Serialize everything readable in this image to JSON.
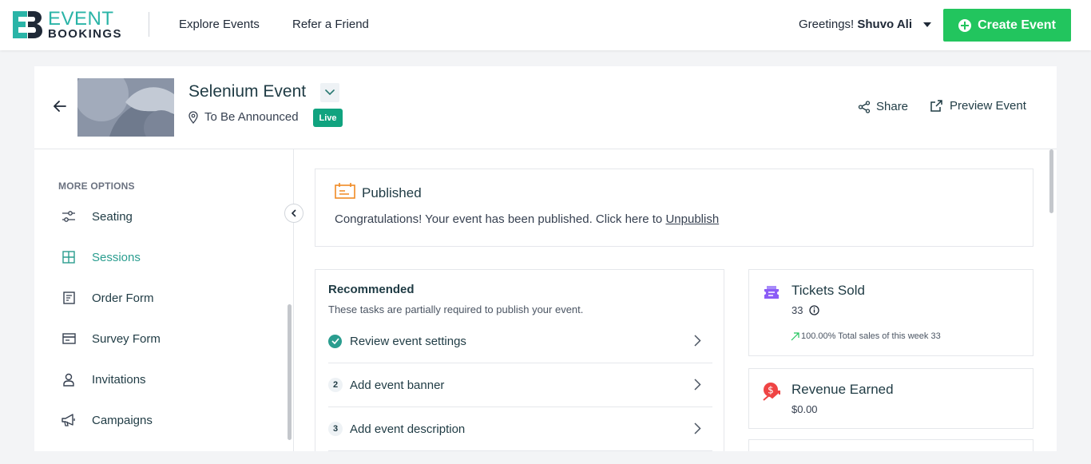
{
  "brand": {
    "logo_line1": "EVENT",
    "logo_line2": "BOOKINGS",
    "colors": {
      "teal": "#2ab4a7",
      "green": "#22c55e",
      "live": "#10a37f"
    }
  },
  "nav": {
    "links": [
      "Explore Events",
      "Refer a Friend"
    ],
    "greeting_prefix": "Greetings!",
    "user_name": "Shuvo Ali",
    "create_label": "Create Event"
  },
  "event": {
    "title": "Selenium Event",
    "location": "To Be Announced",
    "status_badge": "Live",
    "share_label": "Share",
    "preview_label": "Preview Event"
  },
  "sidebar": {
    "section_label": "MORE OPTIONS",
    "items": [
      {
        "label": "Seating",
        "icon": "sliders-icon",
        "active": false
      },
      {
        "label": "Sessions",
        "icon": "grid-icon",
        "active": true
      },
      {
        "label": "Order Form",
        "icon": "form-icon",
        "active": false
      },
      {
        "label": "Survey Form",
        "icon": "card-icon",
        "active": false
      },
      {
        "label": "Invitations",
        "icon": "user-icon",
        "active": false
      },
      {
        "label": "Campaigns",
        "icon": "megaphone-icon",
        "active": false
      }
    ]
  },
  "published": {
    "title": "Published",
    "message": "Congratulations! Your event has been published. Click here to",
    "unpublish_link": "Unpublish"
  },
  "recommended": {
    "title": "Recommended",
    "subtitle": "These tasks are partially required to publish your event.",
    "tasks": [
      {
        "label": "Review event settings",
        "done": true,
        "number": ""
      },
      {
        "label": "Add event banner",
        "done": false,
        "number": "2"
      },
      {
        "label": "Add event description",
        "done": false,
        "number": "3"
      }
    ]
  },
  "stats": {
    "tickets": {
      "title": "Tickets Sold",
      "value": "33",
      "note": "100.00% Total sales of this week 33"
    },
    "revenue": {
      "title": "Revenue Earned",
      "value": "$0.00"
    }
  }
}
